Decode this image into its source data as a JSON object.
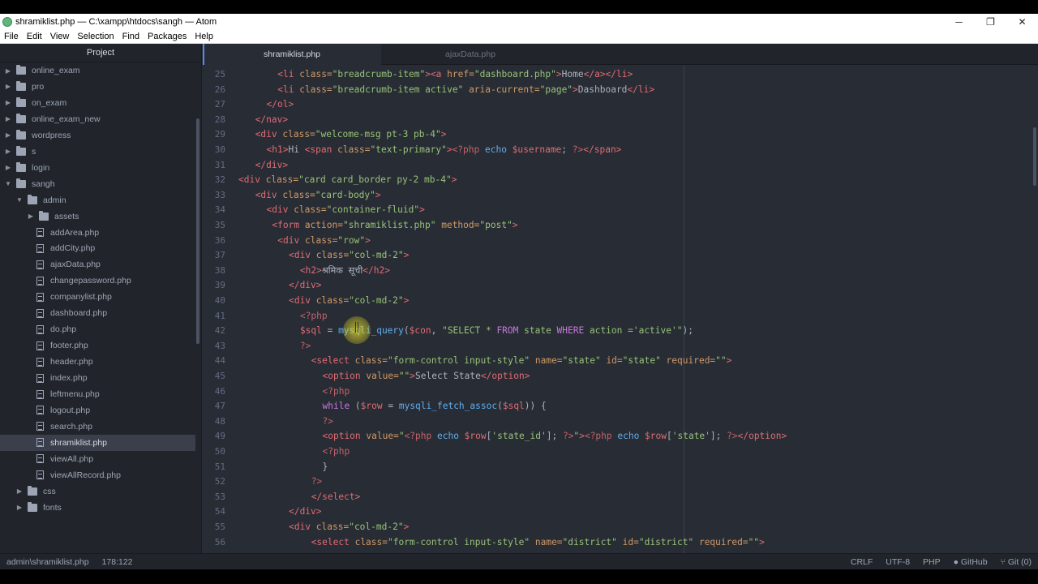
{
  "window": {
    "title": "shramiklist.php — C:\\xampp\\htdocs\\sangh — Atom",
    "controls": [
      "─",
      "❐",
      "✕"
    ]
  },
  "menu": [
    "File",
    "Edit",
    "View",
    "Selection",
    "Find",
    "Packages",
    "Help"
  ],
  "sidebar": {
    "title": "Project",
    "items": [
      {
        "label": "online_exam",
        "type": "folder",
        "depth": 0,
        "expanded": false
      },
      {
        "label": "pro",
        "type": "folder",
        "depth": 0,
        "expanded": false
      },
      {
        "label": "on_exam",
        "type": "folder",
        "depth": 0,
        "expanded": false
      },
      {
        "label": "online_exam_new",
        "type": "folder",
        "depth": 0,
        "expanded": false
      },
      {
        "label": "wordpress",
        "type": "folder",
        "depth": 0,
        "expanded": false
      },
      {
        "label": "s",
        "type": "folder",
        "depth": 0,
        "expanded": false
      },
      {
        "label": "login",
        "type": "folder",
        "depth": 0,
        "expanded": false
      },
      {
        "label": "sangh",
        "type": "folder",
        "depth": 0,
        "expanded": true
      },
      {
        "label": "admin",
        "type": "folder",
        "depth": 1,
        "expanded": true
      },
      {
        "label": "assets",
        "type": "folder",
        "depth": 2,
        "expanded": false
      },
      {
        "label": "addArea.php",
        "type": "file",
        "depth": 2
      },
      {
        "label": "addCity.php",
        "type": "file",
        "depth": 2
      },
      {
        "label": "ajaxData.php",
        "type": "file",
        "depth": 2
      },
      {
        "label": "changepassword.php",
        "type": "file",
        "depth": 2
      },
      {
        "label": "companylist.php",
        "type": "file",
        "depth": 2
      },
      {
        "label": "dashboard.php",
        "type": "file",
        "depth": 2
      },
      {
        "label": "do.php",
        "type": "file",
        "depth": 2
      },
      {
        "label": "footer.php",
        "type": "file",
        "depth": 2
      },
      {
        "label": "header.php",
        "type": "file",
        "depth": 2
      },
      {
        "label": "index.php",
        "type": "file",
        "depth": 2
      },
      {
        "label": "leftmenu.php",
        "type": "file",
        "depth": 2
      },
      {
        "label": "logout.php",
        "type": "file",
        "depth": 2
      },
      {
        "label": "search.php",
        "type": "file",
        "depth": 2
      },
      {
        "label": "shramiklist.php",
        "type": "file",
        "depth": 2,
        "selected": true
      },
      {
        "label": "viewAll.php",
        "type": "file",
        "depth": 2
      },
      {
        "label": "viewAllRecord.php",
        "type": "file",
        "depth": 2
      },
      {
        "label": "css",
        "type": "folder",
        "depth": 1,
        "expanded": false
      },
      {
        "label": "fonts",
        "type": "folder",
        "depth": 1,
        "expanded": false
      }
    ]
  },
  "tabs": [
    {
      "label": "shramiklist.php",
      "active": true
    },
    {
      "label": "ajaxData.php",
      "active": false
    }
  ],
  "code_lines": [
    {
      "n": "25",
      "indent": 7,
      "t": [
        [
          "tag",
          "<li"
        ],
        [
          "attr",
          " class="
        ],
        [
          "str",
          "\"breadcrumb-item\""
        ],
        [
          "tag",
          ">"
        ],
        [
          "tag",
          "<a"
        ],
        [
          "attr",
          " href="
        ],
        [
          "str",
          "\"dashboard.php\""
        ],
        [
          "tag",
          ">"
        ],
        [
          "plain",
          "Home"
        ],
        [
          "tag",
          "</a></li>"
        ]
      ]
    },
    {
      "n": "26",
      "indent": 7,
      "t": [
        [
          "tag",
          "<li"
        ],
        [
          "attr",
          " class="
        ],
        [
          "str",
          "\"breadcrumb-item active\""
        ],
        [
          "attr",
          " aria-current="
        ],
        [
          "str",
          "\"page\""
        ],
        [
          "tag",
          ">"
        ],
        [
          "plain",
          "Dashboard"
        ],
        [
          "tag",
          "</li>"
        ]
      ]
    },
    {
      "n": "27",
      "indent": 5,
      "t": [
        [
          "tag",
          "</ol>"
        ]
      ]
    },
    {
      "n": "28",
      "indent": 3,
      "t": [
        [
          "tag",
          "</nav>"
        ]
      ]
    },
    {
      "n": "29",
      "indent": 3,
      "t": [
        [
          "tag",
          "<div"
        ],
        [
          "attr",
          " class="
        ],
        [
          "str",
          "\"welcome-msg pt-3 pb-4\""
        ],
        [
          "tag",
          ">"
        ]
      ]
    },
    {
      "n": "30",
      "indent": 5,
      "t": [
        [
          "tag",
          "<h1>"
        ],
        [
          "plain",
          "Hi "
        ],
        [
          "tag",
          "<span"
        ],
        [
          "attr",
          " class="
        ],
        [
          "str",
          "\"text-primary\""
        ],
        [
          "tag",
          ">"
        ],
        [
          "php",
          "<?php"
        ],
        [
          "fn",
          " echo"
        ],
        [
          "var",
          " $username"
        ],
        [
          "plain",
          "; "
        ],
        [
          "php",
          "?>"
        ],
        [
          "tag",
          "</span>"
        ]
      ]
    },
    {
      "n": "31",
      "indent": 3,
      "t": [
        [
          "tag",
          "</div>"
        ]
      ]
    },
    {
      "n": "32",
      "indent": 0,
      "t": [
        [
          "tag",
          "<div"
        ],
        [
          "attr",
          " class="
        ],
        [
          "str",
          "\"card card_border py-2 mb-4\""
        ],
        [
          "tag",
          ">"
        ]
      ]
    },
    {
      "n": "33",
      "indent": 3,
      "t": [
        [
          "tag",
          "<div"
        ],
        [
          "attr",
          " class="
        ],
        [
          "str",
          "\"card-body\""
        ],
        [
          "tag",
          ">"
        ]
      ]
    },
    {
      "n": "34",
      "indent": 5,
      "t": [
        [
          "tag",
          "<div"
        ],
        [
          "attr",
          " class="
        ],
        [
          "str",
          "\"container-fluid\""
        ],
        [
          "tag",
          ">"
        ]
      ]
    },
    {
      "n": "35",
      "indent": 6,
      "t": [
        [
          "tag",
          "<form"
        ],
        [
          "attr",
          " action="
        ],
        [
          "str",
          "\"shramiklist.php\""
        ],
        [
          "attr",
          " method="
        ],
        [
          "str",
          "\"post\""
        ],
        [
          "tag",
          ">"
        ]
      ]
    },
    {
      "n": "36",
      "indent": 7,
      "t": [
        [
          "tag",
          "<div"
        ],
        [
          "attr",
          " class="
        ],
        [
          "str",
          "\"row\""
        ],
        [
          "tag",
          ">"
        ]
      ]
    },
    {
      "n": "37",
      "indent": 9,
      "t": [
        [
          "tag",
          "<div"
        ],
        [
          "attr",
          " class="
        ],
        [
          "str",
          "\"col-md-2\""
        ],
        [
          "tag",
          ">"
        ]
      ]
    },
    {
      "n": "38",
      "indent": 11,
      "t": [
        [
          "tag",
          "<h2>"
        ],
        [
          "plain",
          "श्रमिक सूची"
        ],
        [
          "tag",
          "</h2>"
        ]
      ]
    },
    {
      "n": "39",
      "indent": 9,
      "t": [
        [
          "tag",
          "</div>"
        ]
      ]
    },
    {
      "n": "40",
      "indent": 9,
      "t": [
        [
          "tag",
          "<div"
        ],
        [
          "attr",
          " class="
        ],
        [
          "str",
          "\"col-md-2\""
        ],
        [
          "tag",
          ">"
        ]
      ]
    },
    {
      "n": "41",
      "indent": 11,
      "t": [
        [
          "php",
          "<?php"
        ]
      ]
    },
    {
      "n": "42",
      "indent": 11,
      "t": [
        [
          "var",
          "$sql"
        ],
        [
          "plain",
          " = "
        ],
        [
          "fn",
          "mysqli_query"
        ],
        [
          "plain",
          "("
        ],
        [
          "var",
          "$con"
        ],
        [
          "plain",
          ", "
        ],
        [
          "str",
          "\"SELECT * "
        ],
        [
          "kw",
          "FROM"
        ],
        [
          "str",
          " state "
        ],
        [
          "kw",
          "WHERE"
        ],
        [
          "str",
          " action ='active'\""
        ],
        [
          "plain",
          ");"
        ]
      ]
    },
    {
      "n": "43",
      "indent": 11,
      "t": [
        [
          "php",
          "?>"
        ]
      ]
    },
    {
      "n": "44",
      "indent": 13,
      "t": [
        [
          "tag",
          "<select"
        ],
        [
          "attr",
          " class="
        ],
        [
          "str",
          "\"form-control input-style\""
        ],
        [
          "attr",
          " name="
        ],
        [
          "str",
          "\"state\""
        ],
        [
          "attr",
          " id="
        ],
        [
          "str",
          "\"state\""
        ],
        [
          "attr",
          " required="
        ],
        [
          "str",
          "\"\""
        ],
        [
          "tag",
          ">"
        ]
      ]
    },
    {
      "n": "45",
      "indent": 15,
      "t": [
        [
          "tag",
          "<option"
        ],
        [
          "attr",
          " value="
        ],
        [
          "str",
          "\"\""
        ],
        [
          "tag",
          ">"
        ],
        [
          "plain",
          "Select State"
        ],
        [
          "tag",
          "</option>"
        ]
      ]
    },
    {
      "n": "46",
      "indent": 15,
      "t": [
        [
          "php",
          "<?php"
        ]
      ]
    },
    {
      "n": "47",
      "indent": 15,
      "t": [
        [
          "kw",
          "while"
        ],
        [
          "plain",
          " ("
        ],
        [
          "var",
          "$row"
        ],
        [
          "plain",
          " = "
        ],
        [
          "fn",
          "mysqli_fetch_assoc"
        ],
        [
          "plain",
          "("
        ],
        [
          "var",
          "$sql"
        ],
        [
          "plain",
          ")) {"
        ]
      ]
    },
    {
      "n": "48",
      "indent": 15,
      "t": [
        [
          "php",
          "?>"
        ]
      ]
    },
    {
      "n": "49",
      "indent": 15,
      "t": [
        [
          "tag",
          "<option"
        ],
        [
          "attr",
          " value="
        ],
        [
          "str",
          "\""
        ],
        [
          "php",
          "<?php"
        ],
        [
          "fn",
          " echo"
        ],
        [
          "var",
          " $row"
        ],
        [
          "plain",
          "["
        ],
        [
          "str",
          "'state_id'"
        ],
        [
          "plain",
          "]; "
        ],
        [
          "php",
          "?>"
        ],
        [
          "str",
          "\""
        ],
        [
          "tag",
          ">"
        ],
        [
          "php",
          "<?php"
        ],
        [
          "fn",
          " echo"
        ],
        [
          "var",
          " $row"
        ],
        [
          "plain",
          "["
        ],
        [
          "str",
          "'state'"
        ],
        [
          "plain",
          "]; "
        ],
        [
          "php",
          "?>"
        ],
        [
          "tag",
          "</option>"
        ]
      ]
    },
    {
      "n": "50",
      "indent": 15,
      "t": [
        [
          "php",
          "<?php"
        ]
      ]
    },
    {
      "n": "51",
      "indent": 15,
      "t": [
        [
          "plain",
          "}"
        ]
      ]
    },
    {
      "n": "52",
      "indent": 13,
      "t": [
        [
          "php",
          "?>"
        ]
      ]
    },
    {
      "n": "53",
      "indent": 13,
      "t": [
        [
          "tag",
          "</select>"
        ]
      ]
    },
    {
      "n": "54",
      "indent": 9,
      "t": [
        [
          "tag",
          "</div>"
        ]
      ]
    },
    {
      "n": "55",
      "indent": 9,
      "t": [
        [
          "tag",
          "<div"
        ],
        [
          "attr",
          " class="
        ],
        [
          "str",
          "\"col-md-2\""
        ],
        [
          "tag",
          ">"
        ]
      ]
    },
    {
      "n": "56",
      "indent": 13,
      "t": [
        [
          "tag",
          "<select"
        ],
        [
          "attr",
          " class="
        ],
        [
          "str",
          "\"form-control input-style\""
        ],
        [
          "attr",
          " name="
        ],
        [
          "str",
          "\"district\""
        ],
        [
          "attr",
          " id="
        ],
        [
          "str",
          "\"district\""
        ],
        [
          "attr",
          " required="
        ],
        [
          "str",
          "\"\""
        ],
        [
          "tag",
          ">"
        ]
      ]
    }
  ],
  "status": {
    "path": "admin\\shramiklist.php",
    "cursor": "178:122",
    "line_ending": "CRLF",
    "encoding": "UTF-8",
    "grammar": "PHP",
    "github": "GitHub",
    "git": "Git (0)"
  }
}
